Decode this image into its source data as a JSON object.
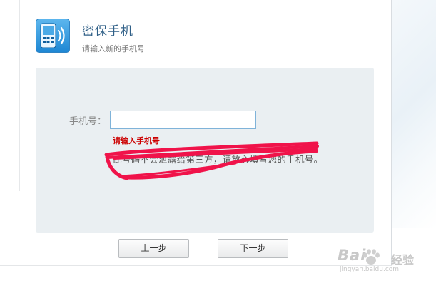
{
  "header": {
    "icon": "mobile-phone-signal-icon",
    "title": "密保手机",
    "subtitle": "请输入新的手机号"
  },
  "form": {
    "phone_label": "手机号：",
    "phone_value": "",
    "error_text": "请输入手机号",
    "hint_text": "此号码不会泄露给第三方，请放心填写您的手机号。"
  },
  "buttons": {
    "prev_label": "上一步",
    "next_label": "下一步"
  },
  "watermark": {
    "brand": "Bai",
    "brand_suffix": "经验",
    "url": "jingyan.baidu.com"
  },
  "colors": {
    "title": "#2f5f87",
    "error": "#cc0000",
    "form_background": "#eaeff2",
    "icon_blue": "#1d86d3",
    "scribble": "#f0134a"
  }
}
